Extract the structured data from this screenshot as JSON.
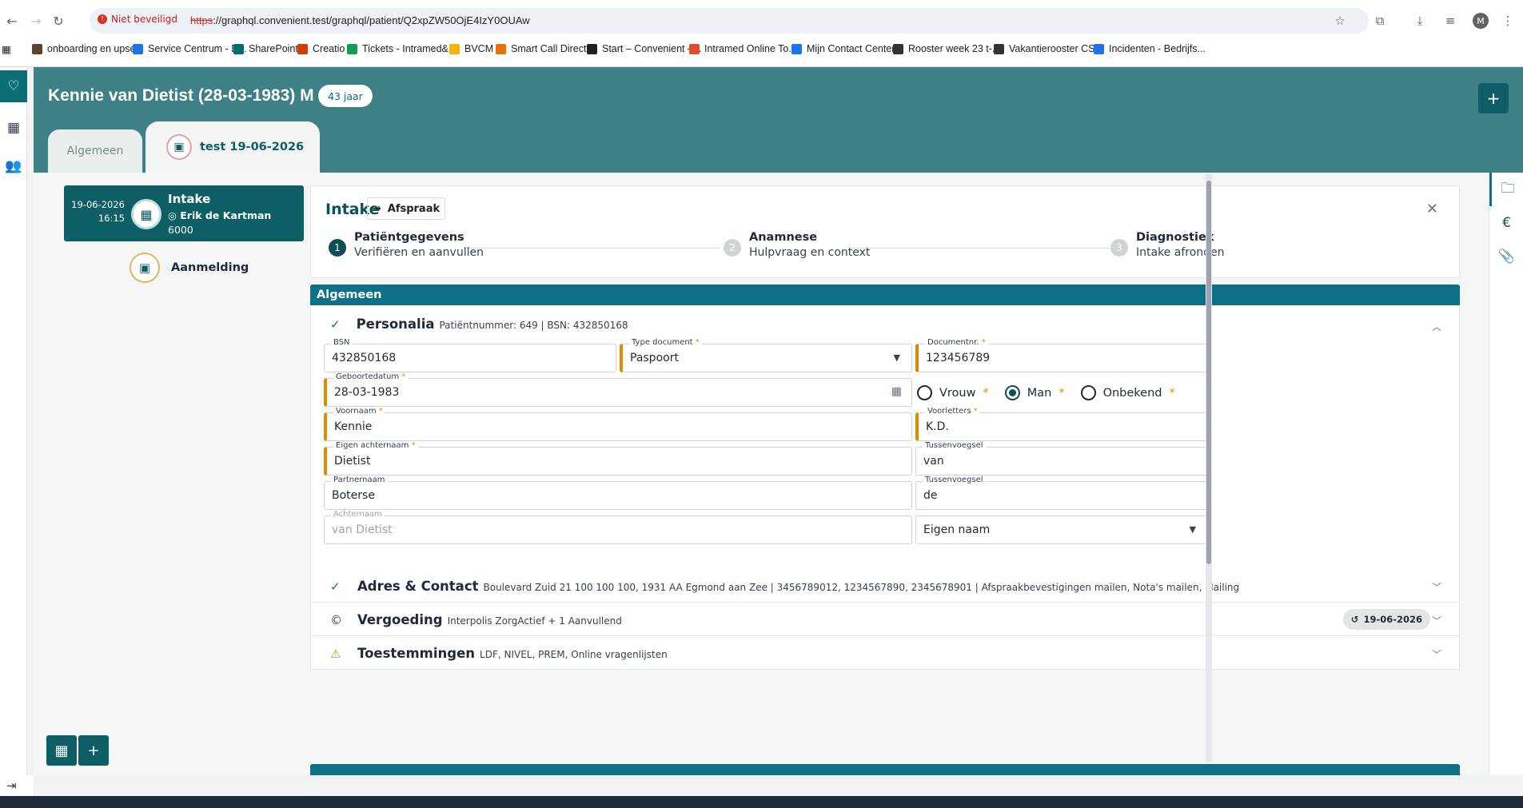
{
  "browser": {
    "security": "Niet beveiligd",
    "url_scheme": "https",
    "url_rest": "://graphql.convenient.test/graphql/patient/Q2xpZW50OjE4IzY0OUAw",
    "profile_initial": "M",
    "bookmarks": [
      "onboarding en upse...",
      "Service Centrum - D...",
      "SharePoint",
      "Creatio",
      "Tickets - Intramed&...",
      "BVCM",
      "Smart Call Director",
      "Start – Convenient –...",
      "Intramed Online To...",
      "Mijn Contact Center...",
      "Rooster week 23 t-...",
      "Vakantierooster CS...",
      "Incidenten - Bedrijfs..."
    ],
    "bookmark_colors": [
      "#5c4033",
      "#1a73e8",
      "#036c70",
      "#d83b01",
      "#0f9d58",
      "#f4b400",
      "#e8710a",
      "#202124",
      "#e34c26",
      "#1a73e8",
      "#333333",
      "#333333",
      "#1a73e8"
    ]
  },
  "header": {
    "patient_title": "Kennie van Dietist (28-03-1983) M",
    "age_badge": "43 jaar",
    "tab_general": "Algemeen",
    "tab_active": "test  19-06-2026"
  },
  "sidebar": {
    "appointment": {
      "date": "19-06-2026",
      "time": "16:15",
      "title": "Intake",
      "therapist": "Erik de Kartman",
      "code": "6000"
    },
    "aanmelding": "Aanmelding"
  },
  "intake": {
    "title": "Intake",
    "afspraak_label": "Afspraak",
    "steps": [
      {
        "num": "1",
        "title": "Patiëntgegevens",
        "sub": "Verifiëren en aanvullen"
      },
      {
        "num": "2",
        "title": "Anamnese",
        "sub": "Hulpvraag en context"
      },
      {
        "num": "3",
        "title": "Diagnostiek",
        "sub": "Intake afronden"
      }
    ]
  },
  "section": {
    "title": "Algemeen"
  },
  "personalia": {
    "title": "Personalia",
    "subtitle": "Patiëntnummer: 649 | BSN: 432850168",
    "fields": {
      "bsn": {
        "label": "BSN",
        "value": "432850168"
      },
      "doc_type": {
        "label": "Type document",
        "value": "Paspoort"
      },
      "doc_nr": {
        "label": "Documentnr.",
        "value": "123456789"
      },
      "dob": {
        "label": "Geboortedatum",
        "value": "28-03-1983"
      },
      "voornaam": {
        "label": "Voornaam",
        "value": "Kennie"
      },
      "voorletters": {
        "label": "Voorletters",
        "value": "K.D."
      },
      "achternaam": {
        "label": "Eigen achternaam",
        "value": "Dietist"
      },
      "tussenvoegsel1": {
        "label": "Tussenvoegsel",
        "value": "van"
      },
      "partnernaam": {
        "label": "Partnernaam",
        "value": "Boterse"
      },
      "tussenvoegsel2": {
        "label": "Tussenvoegsel",
        "value": "de"
      },
      "achternaam_display": {
        "label": "Achternaam",
        "value": "van Dietist"
      },
      "naamgebruik": {
        "value": "Eigen naam"
      }
    },
    "gender": {
      "options": [
        "Vrouw",
        "Man",
        "Onbekend"
      ],
      "selected": "Man"
    }
  },
  "adres": {
    "title": "Adres & Contact",
    "summary": "Boulevard Zuid 21 100 100 100, 1931 AA Egmond aan Zee | 3456789012, 1234567890, 2345678901 | Afspraakbevestigingen mailen, Nota's mailen, Mailing"
  },
  "vergoeding": {
    "title": "Vergoeding",
    "summary": "Interpolis ZorgActief + 1 Aanvullend",
    "date": "19-06-2026"
  },
  "toestemmingen": {
    "title": "Toestemmingen",
    "summary": "LDF, NIVEL, PREM, Online vragenlijsten"
  },
  "colors": {
    "brand": "#3f7f86",
    "dark": "#0e5e66",
    "section": "#0e7086",
    "required": "#e08a00"
  }
}
